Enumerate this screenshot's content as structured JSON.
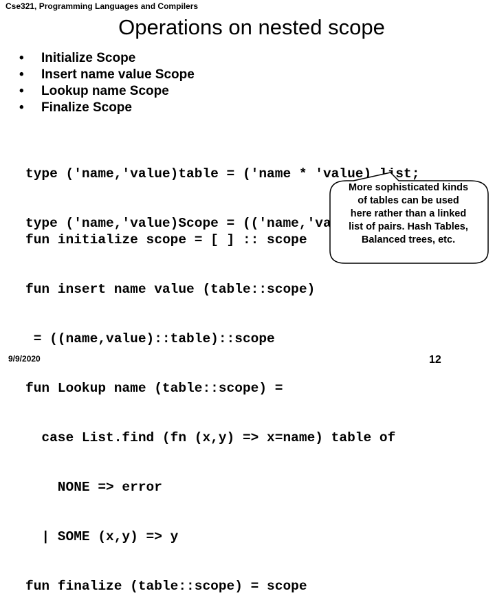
{
  "header": {
    "course": "Cse321, Programming Languages and Compilers"
  },
  "slide": {
    "title": "Operations on nested scope",
    "bullet_glyph": "•",
    "bullets": [
      "Initialize Scope",
      "Insert name value Scope",
      "Lookup name Scope",
      "Finalize Scope"
    ],
    "type_code": [
      "type ('name,'value)table = ('name * 'value) list;",
      "type ('name,'value)Scope = (('name,'value)table) list ;"
    ],
    "fun_code": [
      "fun initialize scope = [ ] :: scope",
      "fun insert name value (table::scope)",
      " = ((name,value)::table)::scope",
      "fun Lookup name (table::scope) =",
      "  case List.find (fn (x,y) => x=name) table of",
      "    NONE => error",
      "  | SOME (x,y) => y",
      "fun finalize (table::scope) = scope"
    ],
    "callout": {
      "lines": [
        "More sophisticated kinds",
        "of tables can be used",
        "here rather than a linked",
        "list of pairs. Hash Tables,",
        "Balanced trees, etc."
      ]
    }
  },
  "footer": {
    "date": "9/9/2020",
    "page_number": "12"
  }
}
